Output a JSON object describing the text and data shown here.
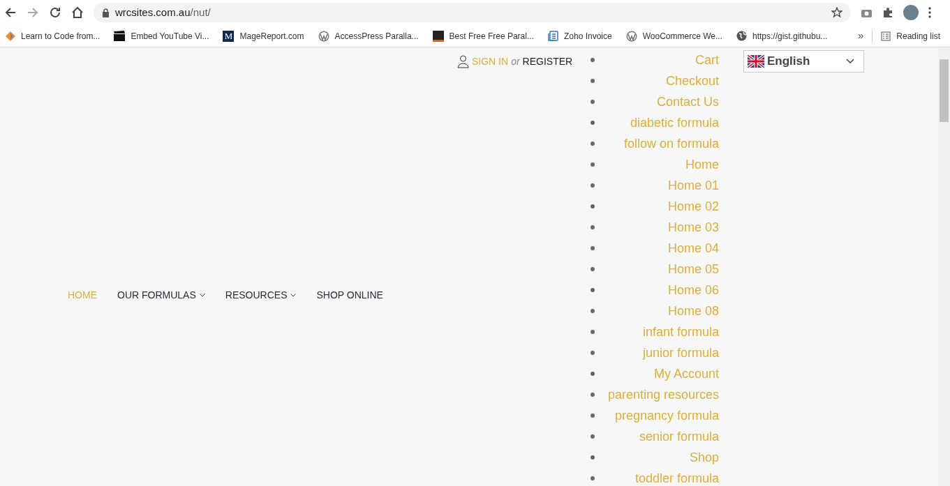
{
  "browser": {
    "url_host": "wrcsites.com.au",
    "url_path": "/nut/",
    "bookmarks": [
      {
        "label": "Learn to Code from...",
        "kind": "diamond"
      },
      {
        "label": "Embed YouTube Vi...",
        "kind": "clapper"
      },
      {
        "label": "MageReport.com",
        "kind": "letter",
        "icon_text": "M"
      },
      {
        "label": "AccessPress Paralla...",
        "kind": "wp"
      },
      {
        "label": "Best Free Free Paral...",
        "kind": "square"
      },
      {
        "label": "Zoho Invoice",
        "kind": "doc"
      },
      {
        "label": "WooCommerce We...",
        "kind": "wp"
      },
      {
        "label": "https://gist.githubu...",
        "kind": "globe"
      }
    ],
    "overflow": "»",
    "reading_list": "Reading list"
  },
  "account": {
    "sign_in": "SIGN IN",
    "or": "or",
    "register": "REGISTER"
  },
  "nav": [
    {
      "label": "HOME",
      "selected": true,
      "dropdown": false
    },
    {
      "label": "OUR FORMULAS",
      "selected": false,
      "dropdown": true
    },
    {
      "label": "RESOURCES",
      "selected": false,
      "dropdown": true
    },
    {
      "label": "SHOP ONLINE",
      "selected": false,
      "dropdown": false
    }
  ],
  "page_list": [
    "Cart",
    "Checkout",
    "Contact Us",
    "diabetic formula",
    "follow on formula",
    "Home",
    "Home 01",
    "Home 02",
    "Home 03",
    "Home 04",
    "Home 05",
    "Home 06",
    "Home 08",
    "infant formula",
    "junior formula",
    "My Account",
    "parenting resources",
    "pregnancy formula",
    "senior formula",
    "Shop",
    "toddler formula"
  ],
  "language": {
    "value": "English"
  }
}
